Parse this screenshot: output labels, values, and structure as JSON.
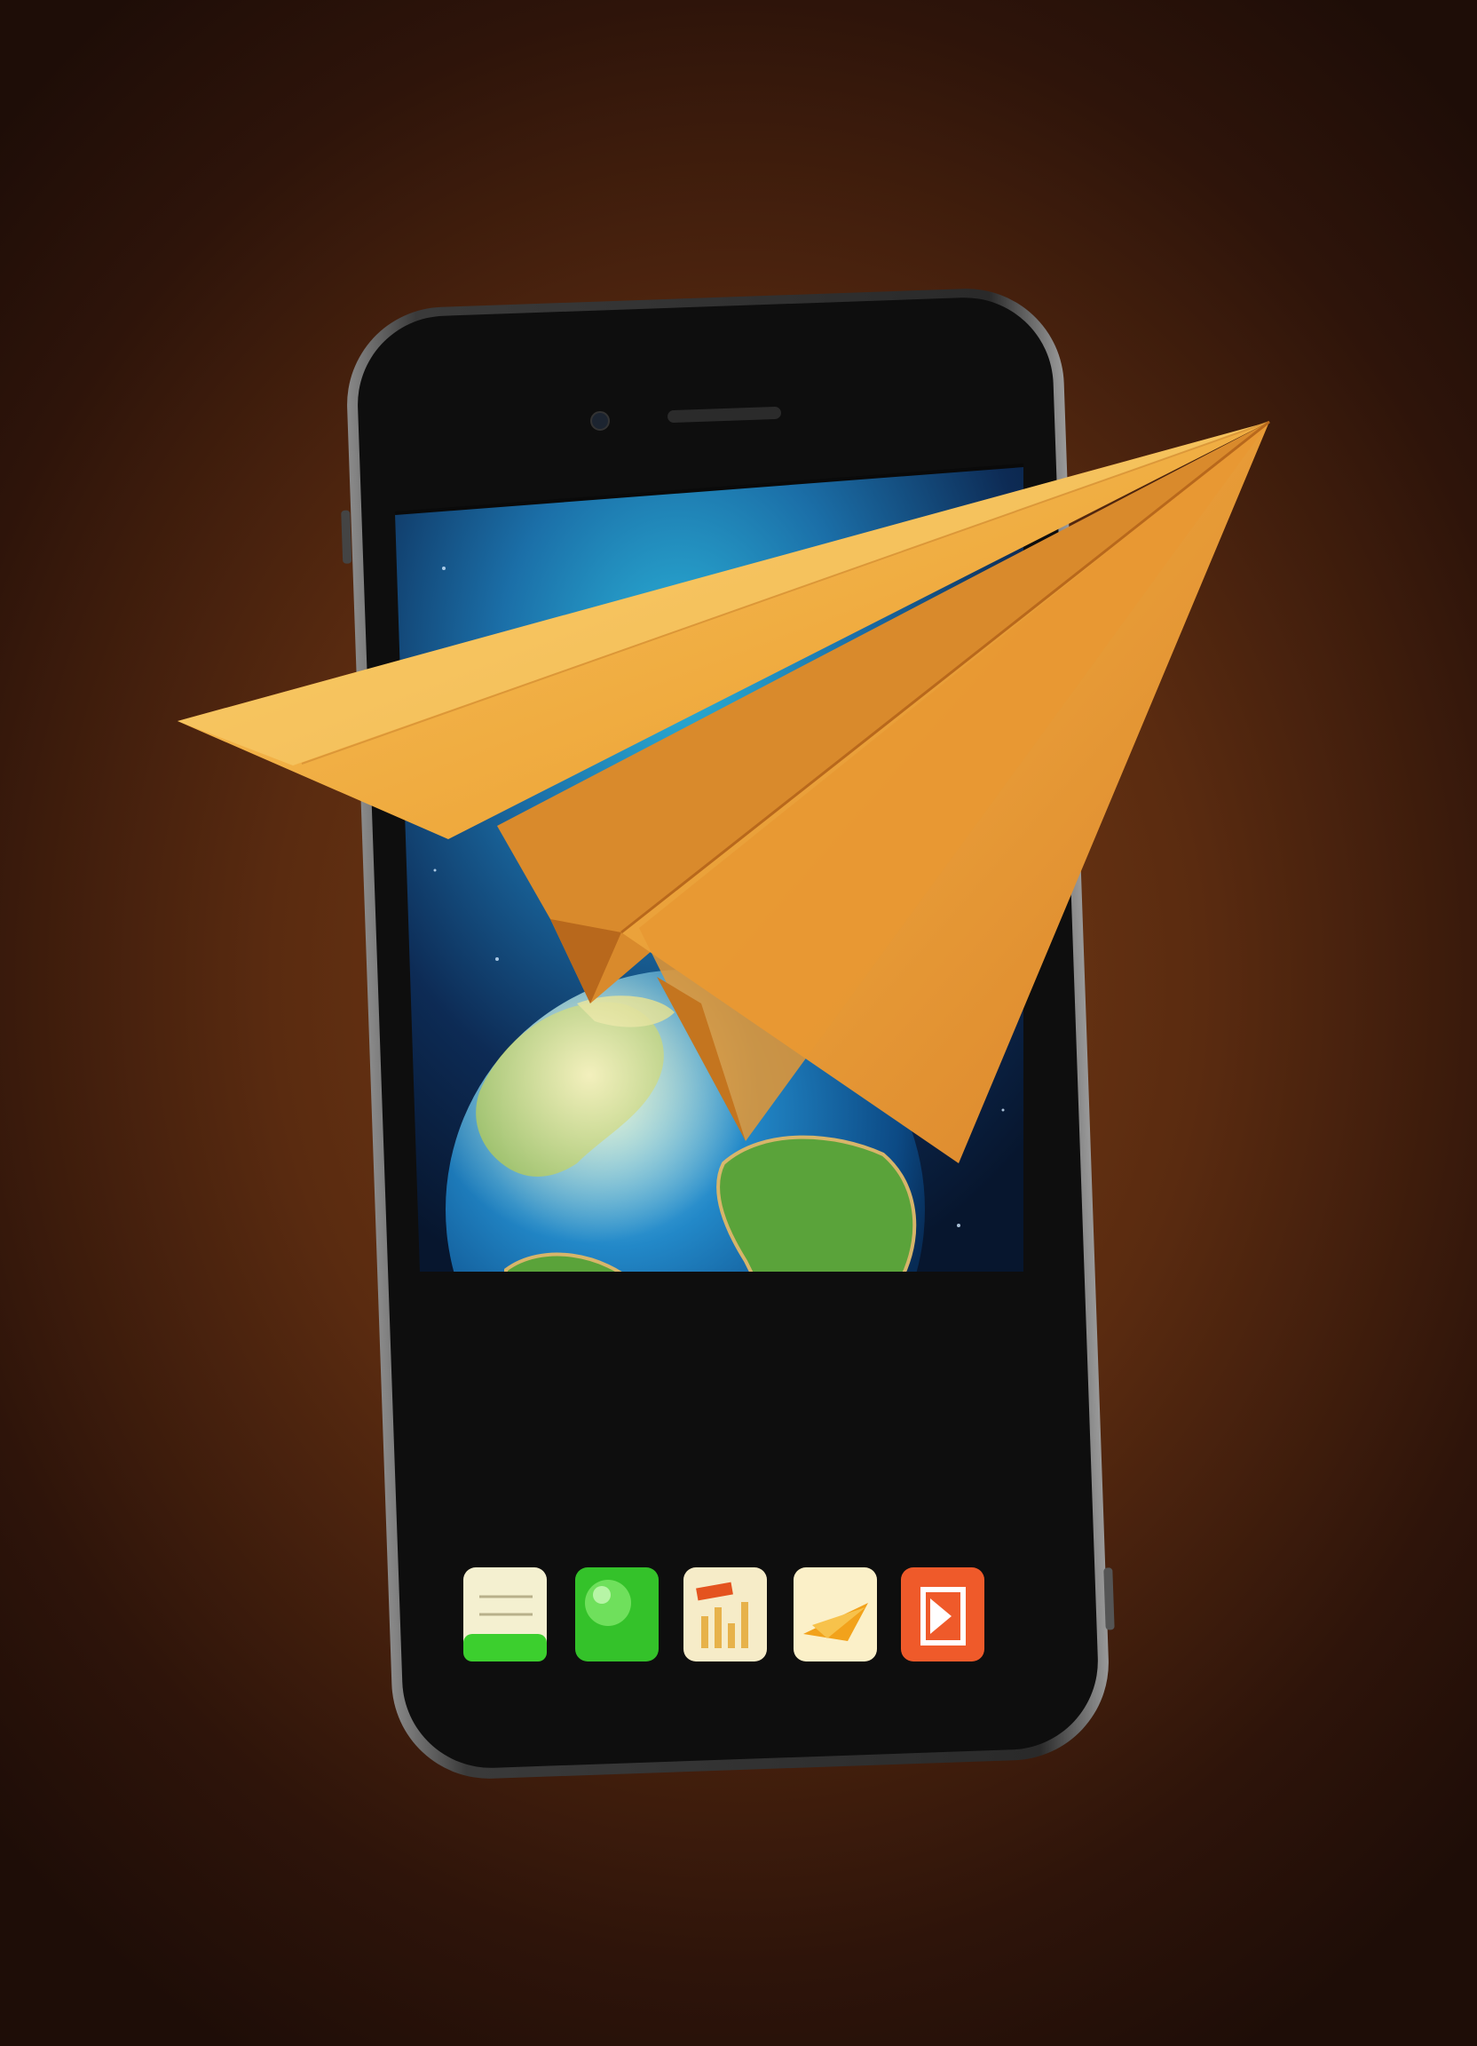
{
  "scene": {
    "background_color": "#5a2b10",
    "phone": {
      "body_color": "#111111",
      "bezel_color": "#6b6b6b",
      "screen_colors": {
        "space_top": "#1a8fc8",
        "space_bottom": "#0a1a33"
      },
      "earth": {
        "ocean": "#1f7fc0",
        "land": "#5aa33a",
        "highlight": "#e8e2a0"
      }
    },
    "paper_plane": {
      "color_light": "#f6b94a",
      "color_mid": "#eea236",
      "color_dark": "#c9771e"
    },
    "dock_icons": [
      {
        "name": "notes-icon",
        "bg": "#f4f0d0",
        "accent": "#3ccf2e"
      },
      {
        "name": "messages-icon",
        "bg": "#34c22a",
        "accent": "#9ff08a"
      },
      {
        "name": "charts-icon",
        "bg": "#f6ecc8",
        "accent": "#e4531f"
      },
      {
        "name": "paper-plane-app-icon",
        "bg": "#fbf0c8",
        "accent": "#f2a21b"
      },
      {
        "name": "video-app-icon",
        "bg": "#ef5a2a",
        "accent": "#ffffff"
      }
    ]
  }
}
